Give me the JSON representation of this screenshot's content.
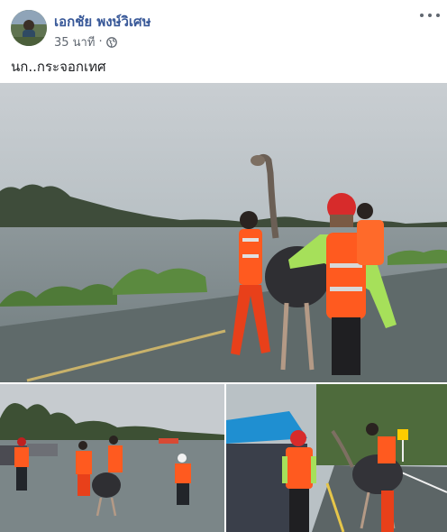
{
  "post": {
    "author_name": "เอกชัย พงษ์วิเศษ",
    "timestamp": "35 นาที",
    "separator": "·",
    "privacy_icon": "globe-icon",
    "more_icon": "more-options-icon",
    "text": "นก..กระจอกเทศ"
  },
  "photos": [
    {
      "name": "photo-main",
      "subject": "ostrich-rescue-flooded-road"
    },
    {
      "name": "photo-bottom-left",
      "subject": "ostrich-walking-floodwater"
    },
    {
      "name": "photo-bottom-right",
      "subject": "ostrich-led-under-tent"
    }
  ],
  "colors": {
    "author_link": "#385898",
    "meta_text": "#606770",
    "life_vest": "#ff5a1f",
    "rescue_shirt": "#a6e05a",
    "tent_blue": "#1f8fd1"
  }
}
